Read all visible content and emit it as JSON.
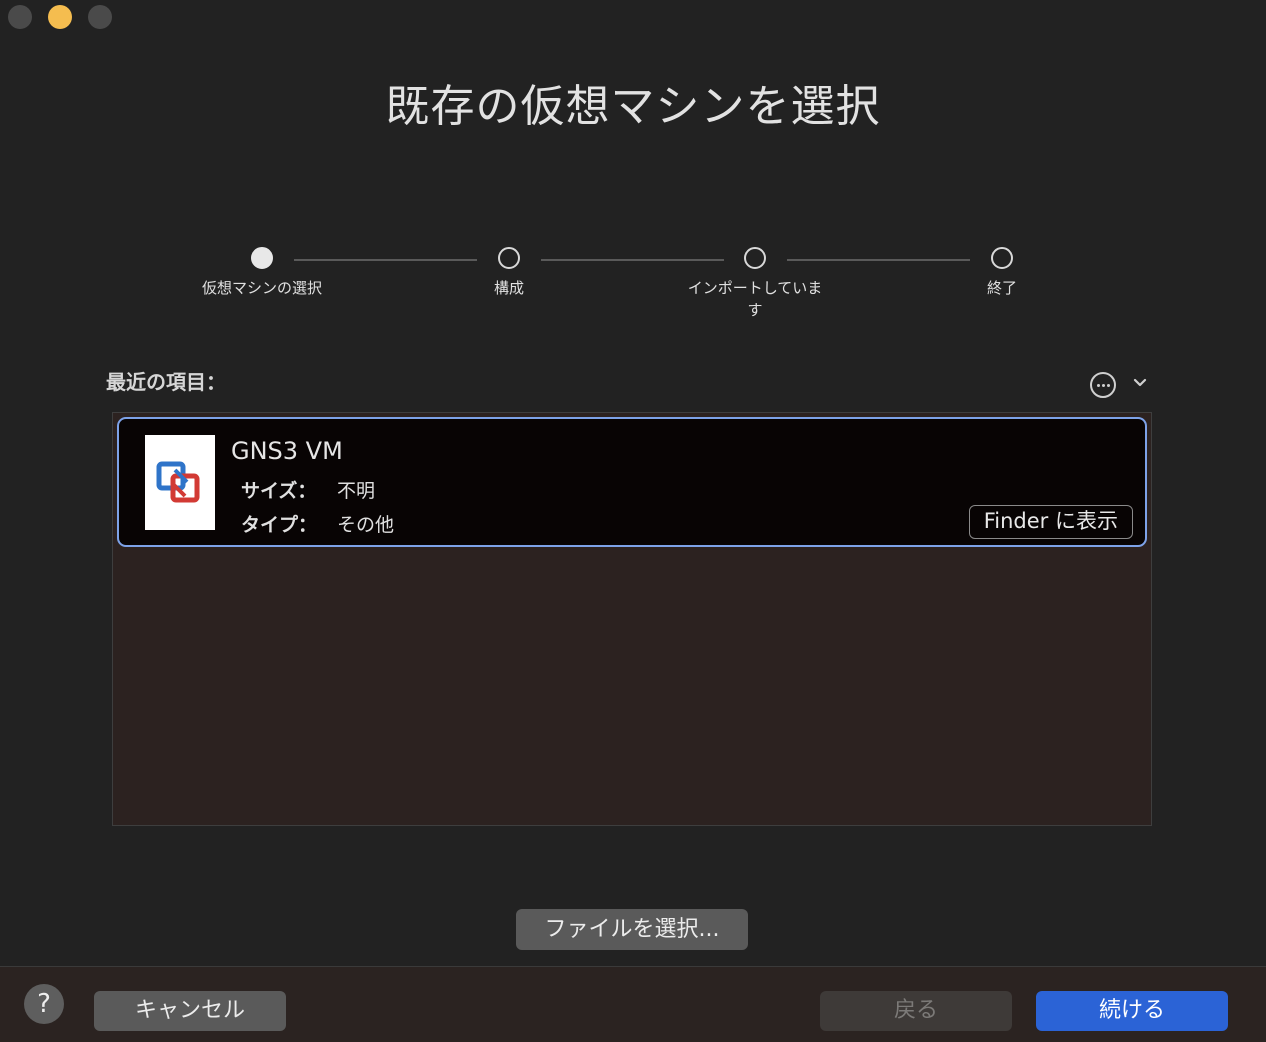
{
  "title": "既存の仮想マシンを選択",
  "steps": [
    {
      "label": "仮想マシンの選択",
      "active": true
    },
    {
      "label": "構成",
      "active": false
    },
    {
      "label": "インポートしています",
      "active": false
    },
    {
      "label": "終了",
      "active": false
    }
  ],
  "recent": {
    "label": "最近の項目："
  },
  "vm": {
    "name": "GNS3 VM",
    "size_key": "サイズ：",
    "size_value": "不明",
    "type_key": "タイプ：",
    "type_value": "その他",
    "finder_label": "Finder に表示"
  },
  "choose_file_label": "ファイルを選択...",
  "footer": {
    "help_label": "?",
    "cancel_label": "キャンセル",
    "back_label": "戻る",
    "continue_label": "続ける"
  },
  "colors": {
    "accent": "#2b63d6",
    "selection_border": "#7da2e8",
    "minimize": "#f5bd4f"
  }
}
